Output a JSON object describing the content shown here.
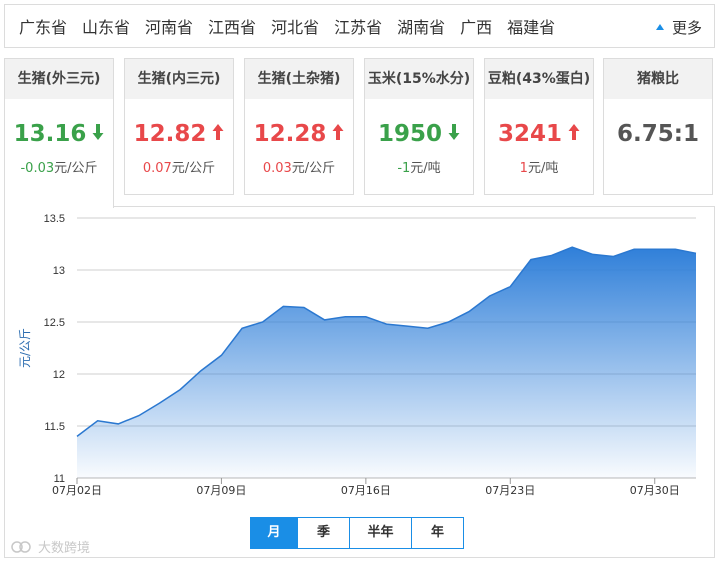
{
  "provinces": [
    "广东省",
    "山东省",
    "河南省",
    "江西省",
    "河北省",
    "江苏省",
    "湖南省",
    "广西",
    "福建省"
  ],
  "more_label": "更多",
  "cards": [
    {
      "title": "生猪(外三元)",
      "value": "13.16",
      "change": "-0.03",
      "unit": "元/公斤",
      "direction": "down"
    },
    {
      "title": "生猪(内三元)",
      "value": "12.82",
      "change": "0.07",
      "unit": "元/公斤",
      "direction": "up"
    },
    {
      "title": "生猪(土杂猪)",
      "value": "12.28",
      "change": "0.03",
      "unit": "元/公斤",
      "direction": "up"
    },
    {
      "title": "玉米(15%水分)",
      "value": "1950",
      "change": "-1",
      "unit": "元/吨",
      "direction": "down"
    },
    {
      "title": "豆粕(43%蛋白)",
      "value": "3241",
      "change": "1",
      "unit": "元/吨",
      "direction": "up"
    },
    {
      "title": "猪粮比",
      "value": "6.75:1",
      "change": "",
      "unit": "",
      "direction": "none"
    }
  ],
  "colors": {
    "up": "#e8484a",
    "down": "#3aa14a",
    "accent": "#1a8ee6",
    "area_top": "#2f7fd9"
  },
  "range_buttons": [
    "月",
    "季",
    "半年",
    "年"
  ],
  "selected_range": "月",
  "watermark": "大数跨境",
  "chart_data": {
    "type": "area",
    "ylabel": "元/公斤",
    "xlabel": "",
    "ylim": [
      11,
      13.5
    ],
    "yticks": [
      11,
      11.5,
      12,
      12.5,
      13,
      13.5
    ],
    "xtick_labels": [
      "07月02日",
      "07月09日",
      "07月16日",
      "07月23日",
      "07月30日"
    ],
    "xtick_days": [
      2,
      9,
      16,
      23,
      30
    ],
    "x_days": [
      2,
      3,
      4,
      5,
      6,
      7,
      8,
      9,
      10,
      11,
      12,
      13,
      14,
      15,
      16,
      17,
      18,
      19,
      20,
      21,
      22,
      23,
      24,
      25,
      26,
      27,
      28,
      29,
      30,
      31,
      32
    ],
    "values": [
      11.4,
      11.55,
      11.52,
      11.6,
      11.72,
      11.85,
      12.03,
      12.18,
      12.44,
      12.5,
      12.65,
      12.64,
      12.52,
      12.55,
      12.55,
      12.48,
      12.46,
      12.44,
      12.5,
      12.6,
      12.75,
      12.84,
      13.1,
      13.14,
      13.22,
      13.15,
      13.13,
      13.2,
      13.2,
      13.2,
      13.16
    ],
    "grid": true,
    "legend": "none"
  }
}
